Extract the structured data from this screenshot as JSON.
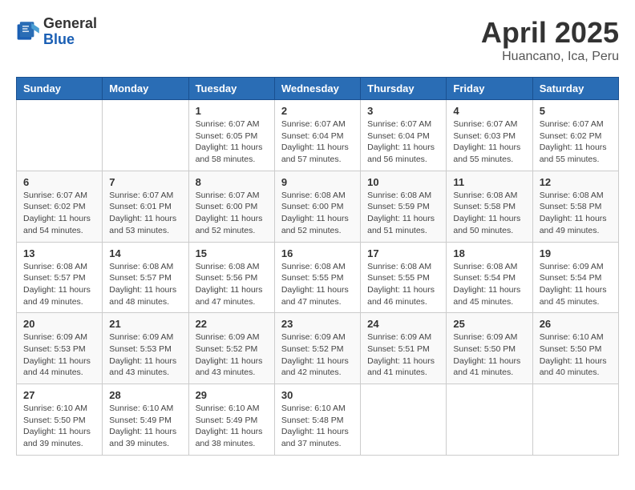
{
  "header": {
    "logo_general": "General",
    "logo_blue": "Blue",
    "month_title": "April 2025",
    "location": "Huancano, Ica, Peru"
  },
  "days_of_week": [
    "Sunday",
    "Monday",
    "Tuesday",
    "Wednesday",
    "Thursday",
    "Friday",
    "Saturday"
  ],
  "weeks": [
    [
      {
        "day": "",
        "info": ""
      },
      {
        "day": "",
        "info": ""
      },
      {
        "day": "1",
        "info": "Sunrise: 6:07 AM\nSunset: 6:05 PM\nDaylight: 11 hours and 58 minutes."
      },
      {
        "day": "2",
        "info": "Sunrise: 6:07 AM\nSunset: 6:04 PM\nDaylight: 11 hours and 57 minutes."
      },
      {
        "day": "3",
        "info": "Sunrise: 6:07 AM\nSunset: 6:04 PM\nDaylight: 11 hours and 56 minutes."
      },
      {
        "day": "4",
        "info": "Sunrise: 6:07 AM\nSunset: 6:03 PM\nDaylight: 11 hours and 55 minutes."
      },
      {
        "day": "5",
        "info": "Sunrise: 6:07 AM\nSunset: 6:02 PM\nDaylight: 11 hours and 55 minutes."
      }
    ],
    [
      {
        "day": "6",
        "info": "Sunrise: 6:07 AM\nSunset: 6:02 PM\nDaylight: 11 hours and 54 minutes."
      },
      {
        "day": "7",
        "info": "Sunrise: 6:07 AM\nSunset: 6:01 PM\nDaylight: 11 hours and 53 minutes."
      },
      {
        "day": "8",
        "info": "Sunrise: 6:07 AM\nSunset: 6:00 PM\nDaylight: 11 hours and 52 minutes."
      },
      {
        "day": "9",
        "info": "Sunrise: 6:08 AM\nSunset: 6:00 PM\nDaylight: 11 hours and 52 minutes."
      },
      {
        "day": "10",
        "info": "Sunrise: 6:08 AM\nSunset: 5:59 PM\nDaylight: 11 hours and 51 minutes."
      },
      {
        "day": "11",
        "info": "Sunrise: 6:08 AM\nSunset: 5:58 PM\nDaylight: 11 hours and 50 minutes."
      },
      {
        "day": "12",
        "info": "Sunrise: 6:08 AM\nSunset: 5:58 PM\nDaylight: 11 hours and 49 minutes."
      }
    ],
    [
      {
        "day": "13",
        "info": "Sunrise: 6:08 AM\nSunset: 5:57 PM\nDaylight: 11 hours and 49 minutes."
      },
      {
        "day": "14",
        "info": "Sunrise: 6:08 AM\nSunset: 5:57 PM\nDaylight: 11 hours and 48 minutes."
      },
      {
        "day": "15",
        "info": "Sunrise: 6:08 AM\nSunset: 5:56 PM\nDaylight: 11 hours and 47 minutes."
      },
      {
        "day": "16",
        "info": "Sunrise: 6:08 AM\nSunset: 5:55 PM\nDaylight: 11 hours and 47 minutes."
      },
      {
        "day": "17",
        "info": "Sunrise: 6:08 AM\nSunset: 5:55 PM\nDaylight: 11 hours and 46 minutes."
      },
      {
        "day": "18",
        "info": "Sunrise: 6:08 AM\nSunset: 5:54 PM\nDaylight: 11 hours and 45 minutes."
      },
      {
        "day": "19",
        "info": "Sunrise: 6:09 AM\nSunset: 5:54 PM\nDaylight: 11 hours and 45 minutes."
      }
    ],
    [
      {
        "day": "20",
        "info": "Sunrise: 6:09 AM\nSunset: 5:53 PM\nDaylight: 11 hours and 44 minutes."
      },
      {
        "day": "21",
        "info": "Sunrise: 6:09 AM\nSunset: 5:53 PM\nDaylight: 11 hours and 43 minutes."
      },
      {
        "day": "22",
        "info": "Sunrise: 6:09 AM\nSunset: 5:52 PM\nDaylight: 11 hours and 43 minutes."
      },
      {
        "day": "23",
        "info": "Sunrise: 6:09 AM\nSunset: 5:52 PM\nDaylight: 11 hours and 42 minutes."
      },
      {
        "day": "24",
        "info": "Sunrise: 6:09 AM\nSunset: 5:51 PM\nDaylight: 11 hours and 41 minutes."
      },
      {
        "day": "25",
        "info": "Sunrise: 6:09 AM\nSunset: 5:50 PM\nDaylight: 11 hours and 41 minutes."
      },
      {
        "day": "26",
        "info": "Sunrise: 6:10 AM\nSunset: 5:50 PM\nDaylight: 11 hours and 40 minutes."
      }
    ],
    [
      {
        "day": "27",
        "info": "Sunrise: 6:10 AM\nSunset: 5:50 PM\nDaylight: 11 hours and 39 minutes."
      },
      {
        "day": "28",
        "info": "Sunrise: 6:10 AM\nSunset: 5:49 PM\nDaylight: 11 hours and 39 minutes."
      },
      {
        "day": "29",
        "info": "Sunrise: 6:10 AM\nSunset: 5:49 PM\nDaylight: 11 hours and 38 minutes."
      },
      {
        "day": "30",
        "info": "Sunrise: 6:10 AM\nSunset: 5:48 PM\nDaylight: 11 hours and 37 minutes."
      },
      {
        "day": "",
        "info": ""
      },
      {
        "day": "",
        "info": ""
      },
      {
        "day": "",
        "info": ""
      }
    ]
  ]
}
